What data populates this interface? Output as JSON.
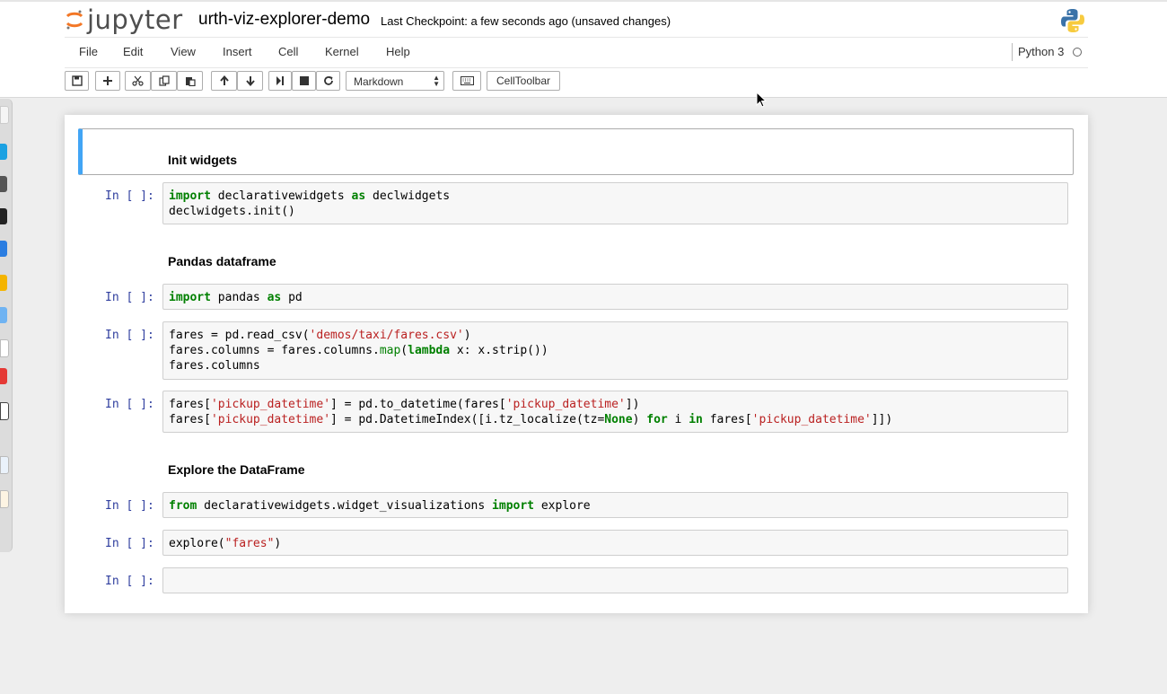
{
  "header": {
    "logo_text": "jupyter",
    "notebook_name": "urth-viz-explorer-demo",
    "checkpoint": "Last Checkpoint: a few seconds ago (unsaved changes)"
  },
  "menu": [
    "File",
    "Edit",
    "View",
    "Insert",
    "Cell",
    "Kernel",
    "Help"
  ],
  "kernel": {
    "name": "Python 3"
  },
  "toolbar": {
    "cell_type": "Markdown",
    "celltoolbar_label": "CellToolbar",
    "icons": [
      "save-icon",
      "plus-icon",
      "cut-icon",
      "copy-icon",
      "paste-icon",
      "arrow-up-icon",
      "arrow-down-icon",
      "run-icon",
      "stop-icon",
      "restart-icon",
      "keyboard-icon"
    ]
  },
  "cells": {
    "md1": "Init widgets",
    "md2": "Pandas dataframe",
    "md3": "Explore the DataFrame",
    "prompt": "In [ ]:",
    "c1": {
      "l1": {
        "a": "import",
        "b": " declarativewidgets ",
        "c": "as",
        "d": " declwidgets"
      },
      "l2": "declwidgets.init()"
    },
    "c2": {
      "a": "import",
      "b": " pandas ",
      "c": "as",
      "d": " pd"
    },
    "c3": {
      "l1": {
        "a": "fares = pd.read_csv(",
        "b": "'demos/taxi/fares.csv'",
        "c": ")"
      },
      "l2": {
        "a": "fares.columns = fares.columns.",
        "b": "map",
        "c": "(",
        "d": "lambda",
        "e": " x: x.strip())"
      },
      "l3": "fares.columns"
    },
    "c4": {
      "l1": {
        "a": "fares[",
        "b": "'pickup_datetime'",
        "c": "] = pd.to_datetime(fares[",
        "d": "'pickup_datetime'",
        "e": "])"
      },
      "l2": {
        "a": "fares[",
        "b": "'pickup_datetime'",
        "c": "] = pd.DatetimeIndex([i.tz_localize(tz=",
        "d": "None",
        "e": ") ",
        "f": "for",
        "g": " i ",
        "h": "in",
        "i": " fares[",
        "j": "'pickup_datetime'",
        "k": "]])"
      }
    },
    "c5": {
      "a": "from",
      "b": " declarativewidgets.widget_visualizations ",
      "c": "import",
      "d": " explore"
    },
    "c6": {
      "a": "explore(",
      "b": "\"fares\"",
      "c": ")"
    }
  }
}
